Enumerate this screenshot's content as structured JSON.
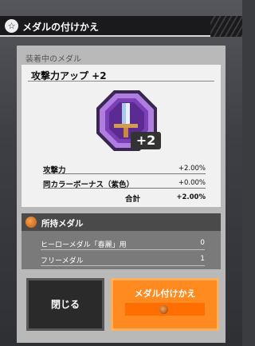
{
  "header": {
    "title": "メダルの付けかえ",
    "icon": "hero-emblem-icon"
  },
  "equipped": {
    "section_label": "装着中のメダル",
    "medal_name": "攻撃力アップ +2",
    "medal_plus": "+2",
    "medal_icon": "sword-medal-icon",
    "medal_color": "#8e4fc8",
    "stats": [
      {
        "label": "攻撃力",
        "value": "+2.00%"
      },
      {
        "label": "同カラーボーナス（紫色）",
        "value": "+0.00%"
      }
    ],
    "total_label": "合計",
    "total_value": "+2.00%"
  },
  "owned": {
    "title": "所持メダル",
    "icon": "medal-coin-icon",
    "rows": [
      {
        "label": "ヒーローメダル「春麗」用",
        "value": "0"
      },
      {
        "label": "フリーメダル",
        "value": "1"
      }
    ]
  },
  "buttons": {
    "close_label": "閉じる",
    "swap_label": "メダル付けかえ",
    "swap_color": "#ff8a1f"
  }
}
